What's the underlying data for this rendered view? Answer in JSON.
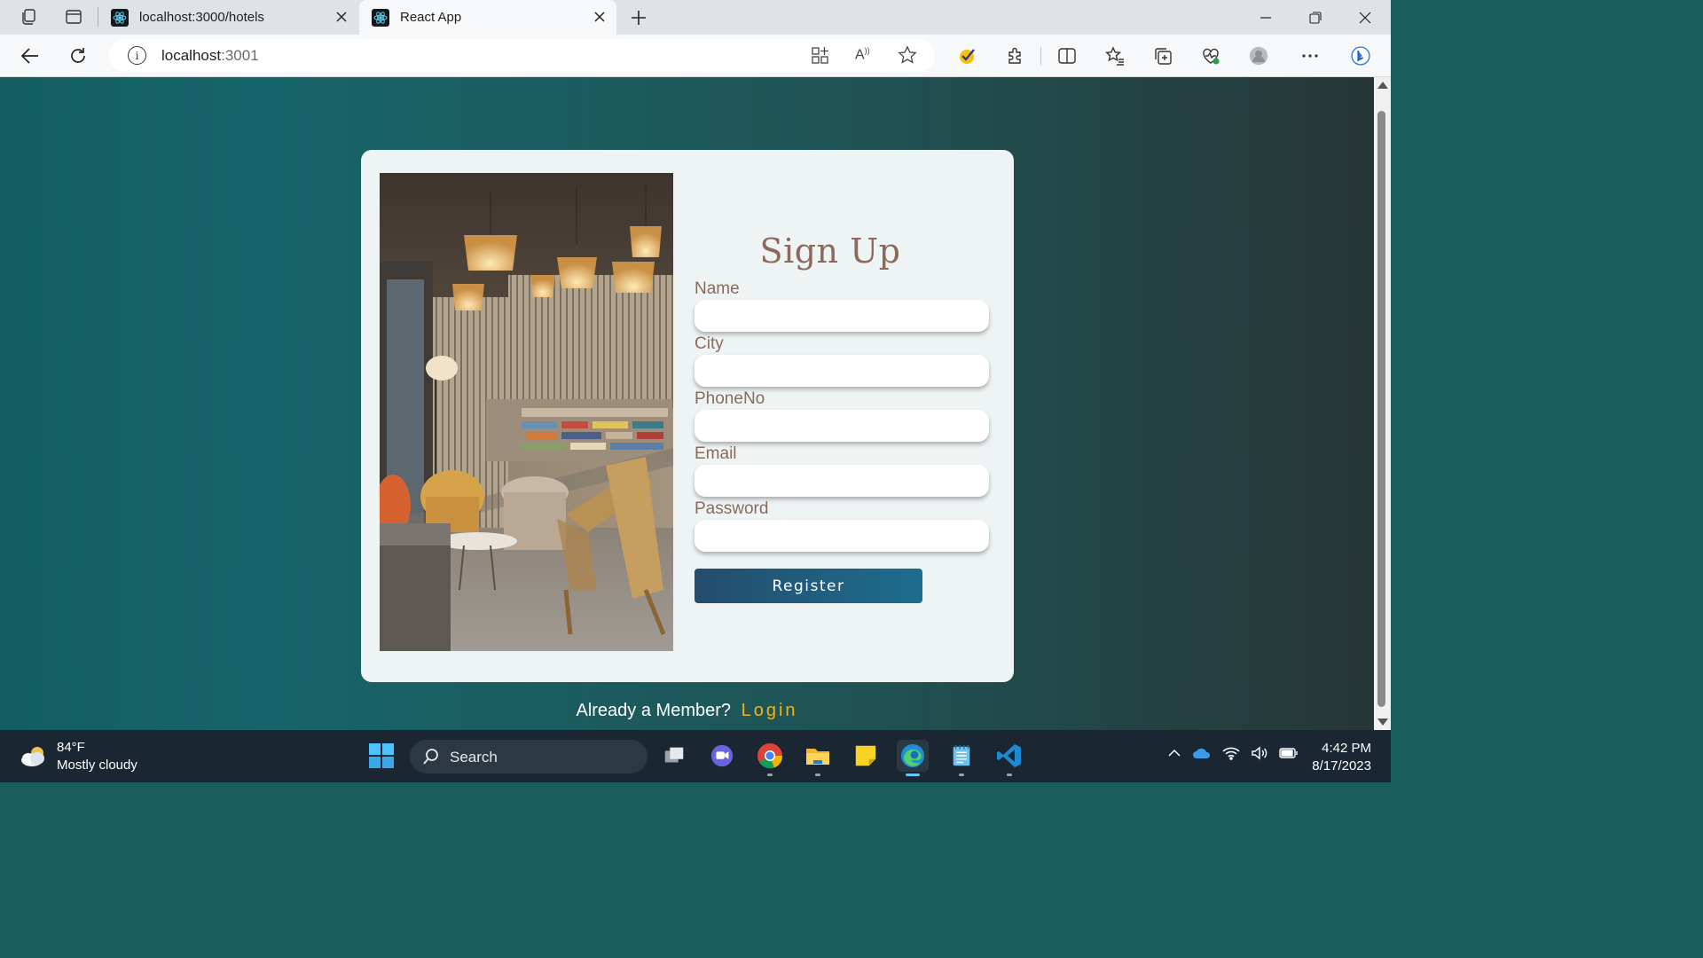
{
  "browser": {
    "tabs": [
      {
        "title": "localhost:3000/hotels",
        "active": false
      },
      {
        "title": "React App",
        "active": true
      }
    ],
    "address": {
      "host": "localhost",
      "port": ":3001"
    }
  },
  "page": {
    "heading": "Sign Up",
    "fields": [
      {
        "label": "Name",
        "value": ""
      },
      {
        "label": "City",
        "value": ""
      },
      {
        "label": "PhoneNo",
        "value": ""
      },
      {
        "label": "Email",
        "value": ""
      },
      {
        "label": "Password",
        "value": ""
      }
    ],
    "register_label": "Register",
    "member_text": "Already a Member?",
    "login_label": "Login",
    "colors": {
      "label": "#8b6a5e",
      "login": "#f2b21c",
      "button_start": "#244c6c",
      "button_end": "#1d6d8e"
    }
  },
  "taskbar": {
    "weather": {
      "temp": "84°F",
      "condition": "Mostly cloudy"
    },
    "search_label": "Search",
    "apps": [
      "task-view",
      "teams-chat",
      "chrome",
      "file-explorer",
      "sticky-notes",
      "edge",
      "notepad",
      "vscode"
    ],
    "time": "4:42 PM",
    "date": "8/17/2023"
  }
}
